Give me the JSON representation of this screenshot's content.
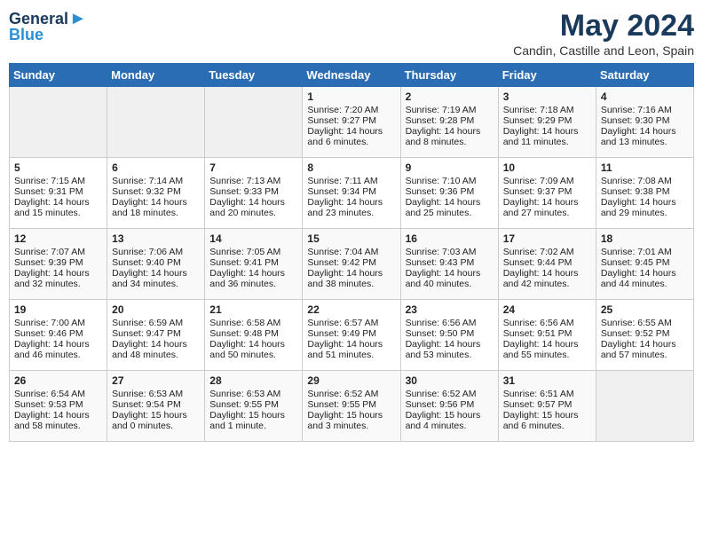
{
  "header": {
    "logo_general": "General",
    "logo_blue": "Blue",
    "title": "May 2024",
    "subtitle": "Candin, Castille and Leon, Spain"
  },
  "weekdays": [
    "Sunday",
    "Monday",
    "Tuesday",
    "Wednesday",
    "Thursday",
    "Friday",
    "Saturday"
  ],
  "weeks": [
    [
      {
        "day": "",
        "sunrise": "",
        "sunset": "",
        "daylight": ""
      },
      {
        "day": "",
        "sunrise": "",
        "sunset": "",
        "daylight": ""
      },
      {
        "day": "",
        "sunrise": "",
        "sunset": "",
        "daylight": ""
      },
      {
        "day": "1",
        "sunrise": "Sunrise: 7:20 AM",
        "sunset": "Sunset: 9:27 PM",
        "daylight": "Daylight: 14 hours and 6 minutes."
      },
      {
        "day": "2",
        "sunrise": "Sunrise: 7:19 AM",
        "sunset": "Sunset: 9:28 PM",
        "daylight": "Daylight: 14 hours and 8 minutes."
      },
      {
        "day": "3",
        "sunrise": "Sunrise: 7:18 AM",
        "sunset": "Sunset: 9:29 PM",
        "daylight": "Daylight: 14 hours and 11 minutes."
      },
      {
        "day": "4",
        "sunrise": "Sunrise: 7:16 AM",
        "sunset": "Sunset: 9:30 PM",
        "daylight": "Daylight: 14 hours and 13 minutes."
      }
    ],
    [
      {
        "day": "5",
        "sunrise": "Sunrise: 7:15 AM",
        "sunset": "Sunset: 9:31 PM",
        "daylight": "Daylight: 14 hours and 15 minutes."
      },
      {
        "day": "6",
        "sunrise": "Sunrise: 7:14 AM",
        "sunset": "Sunset: 9:32 PM",
        "daylight": "Daylight: 14 hours and 18 minutes."
      },
      {
        "day": "7",
        "sunrise": "Sunrise: 7:13 AM",
        "sunset": "Sunset: 9:33 PM",
        "daylight": "Daylight: 14 hours and 20 minutes."
      },
      {
        "day": "8",
        "sunrise": "Sunrise: 7:11 AM",
        "sunset": "Sunset: 9:34 PM",
        "daylight": "Daylight: 14 hours and 23 minutes."
      },
      {
        "day": "9",
        "sunrise": "Sunrise: 7:10 AM",
        "sunset": "Sunset: 9:36 PM",
        "daylight": "Daylight: 14 hours and 25 minutes."
      },
      {
        "day": "10",
        "sunrise": "Sunrise: 7:09 AM",
        "sunset": "Sunset: 9:37 PM",
        "daylight": "Daylight: 14 hours and 27 minutes."
      },
      {
        "day": "11",
        "sunrise": "Sunrise: 7:08 AM",
        "sunset": "Sunset: 9:38 PM",
        "daylight": "Daylight: 14 hours and 29 minutes."
      }
    ],
    [
      {
        "day": "12",
        "sunrise": "Sunrise: 7:07 AM",
        "sunset": "Sunset: 9:39 PM",
        "daylight": "Daylight: 14 hours and 32 minutes."
      },
      {
        "day": "13",
        "sunrise": "Sunrise: 7:06 AM",
        "sunset": "Sunset: 9:40 PM",
        "daylight": "Daylight: 14 hours and 34 minutes."
      },
      {
        "day": "14",
        "sunrise": "Sunrise: 7:05 AM",
        "sunset": "Sunset: 9:41 PM",
        "daylight": "Daylight: 14 hours and 36 minutes."
      },
      {
        "day": "15",
        "sunrise": "Sunrise: 7:04 AM",
        "sunset": "Sunset: 9:42 PM",
        "daylight": "Daylight: 14 hours and 38 minutes."
      },
      {
        "day": "16",
        "sunrise": "Sunrise: 7:03 AM",
        "sunset": "Sunset: 9:43 PM",
        "daylight": "Daylight: 14 hours and 40 minutes."
      },
      {
        "day": "17",
        "sunrise": "Sunrise: 7:02 AM",
        "sunset": "Sunset: 9:44 PM",
        "daylight": "Daylight: 14 hours and 42 minutes."
      },
      {
        "day": "18",
        "sunrise": "Sunrise: 7:01 AM",
        "sunset": "Sunset: 9:45 PM",
        "daylight": "Daylight: 14 hours and 44 minutes."
      }
    ],
    [
      {
        "day": "19",
        "sunrise": "Sunrise: 7:00 AM",
        "sunset": "Sunset: 9:46 PM",
        "daylight": "Daylight: 14 hours and 46 minutes."
      },
      {
        "day": "20",
        "sunrise": "Sunrise: 6:59 AM",
        "sunset": "Sunset: 9:47 PM",
        "daylight": "Daylight: 14 hours and 48 minutes."
      },
      {
        "day": "21",
        "sunrise": "Sunrise: 6:58 AM",
        "sunset": "Sunset: 9:48 PM",
        "daylight": "Daylight: 14 hours and 50 minutes."
      },
      {
        "day": "22",
        "sunrise": "Sunrise: 6:57 AM",
        "sunset": "Sunset: 9:49 PM",
        "daylight": "Daylight: 14 hours and 51 minutes."
      },
      {
        "day": "23",
        "sunrise": "Sunrise: 6:56 AM",
        "sunset": "Sunset: 9:50 PM",
        "daylight": "Daylight: 14 hours and 53 minutes."
      },
      {
        "day": "24",
        "sunrise": "Sunrise: 6:56 AM",
        "sunset": "Sunset: 9:51 PM",
        "daylight": "Daylight: 14 hours and 55 minutes."
      },
      {
        "day": "25",
        "sunrise": "Sunrise: 6:55 AM",
        "sunset": "Sunset: 9:52 PM",
        "daylight": "Daylight: 14 hours and 57 minutes."
      }
    ],
    [
      {
        "day": "26",
        "sunrise": "Sunrise: 6:54 AM",
        "sunset": "Sunset: 9:53 PM",
        "daylight": "Daylight: 14 hours and 58 minutes."
      },
      {
        "day": "27",
        "sunrise": "Sunrise: 6:53 AM",
        "sunset": "Sunset: 9:54 PM",
        "daylight": "Daylight: 15 hours and 0 minutes."
      },
      {
        "day": "28",
        "sunrise": "Sunrise: 6:53 AM",
        "sunset": "Sunset: 9:55 PM",
        "daylight": "Daylight: 15 hours and 1 minute."
      },
      {
        "day": "29",
        "sunrise": "Sunrise: 6:52 AM",
        "sunset": "Sunset: 9:55 PM",
        "daylight": "Daylight: 15 hours and 3 minutes."
      },
      {
        "day": "30",
        "sunrise": "Sunrise: 6:52 AM",
        "sunset": "Sunset: 9:56 PM",
        "daylight": "Daylight: 15 hours and 4 minutes."
      },
      {
        "day": "31",
        "sunrise": "Sunrise: 6:51 AM",
        "sunset": "Sunset: 9:57 PM",
        "daylight": "Daylight: 15 hours and 6 minutes."
      },
      {
        "day": "",
        "sunrise": "",
        "sunset": "",
        "daylight": ""
      }
    ]
  ]
}
